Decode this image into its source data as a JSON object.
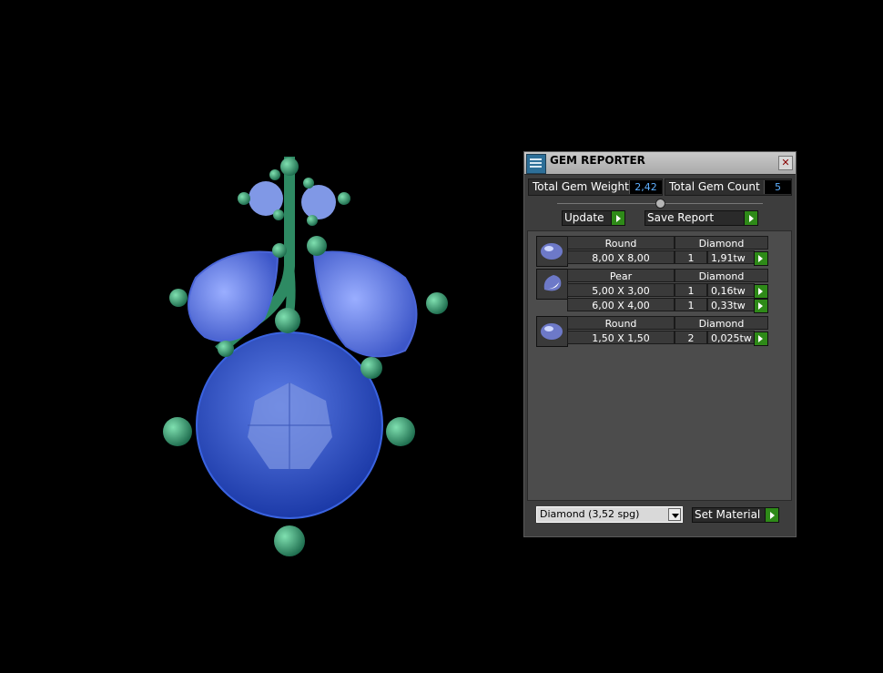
{
  "panel": {
    "title": "GEM REPORTER",
    "close": "✕",
    "total_weight_label": "Total Gem Weight",
    "total_weight_value": "2,42",
    "total_count_label": "Total Gem Count",
    "total_count_value": "5",
    "update_label": "Update",
    "save_report_label": "Save Report",
    "groups": [
      {
        "shape": "Round",
        "material": "Diamond",
        "rows": [
          {
            "size": "8,00 X 8,00",
            "qty": "1",
            "weight": "1,91tw"
          }
        ]
      },
      {
        "shape": "Pear",
        "material": "Diamond",
        "rows": [
          {
            "size": "5,00 X 3,00",
            "qty": "1",
            "weight": "0,16tw"
          },
          {
            "size": "6,00 X 4,00",
            "qty": "1",
            "weight": "0,33tw"
          }
        ]
      },
      {
        "shape": "Round",
        "material": "Diamond",
        "rows": [
          {
            "size": "1,50 X 1,50",
            "qty": "2",
            "weight": "0,025tw"
          }
        ]
      }
    ],
    "material_select": "Diamond     (3,52 spg)",
    "set_material_label": "Set Material"
  },
  "colors": {
    "accent_green": "#2e8a18",
    "value_blue": "#5fb0ff",
    "gem_blue": "#2f55c8",
    "metal_green": "#2f8a66"
  }
}
